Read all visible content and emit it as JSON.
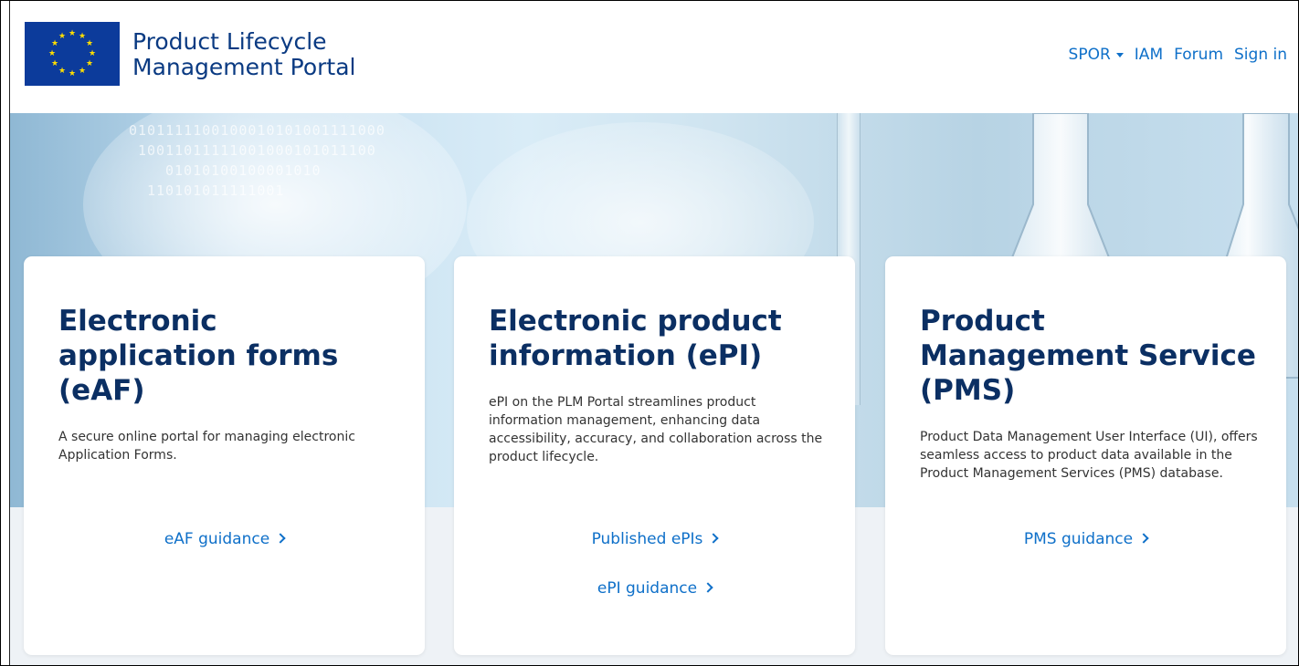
{
  "header": {
    "logo_alt": "EU flag",
    "brand_line1": "Product Lifecycle",
    "brand_line2": "Management Portal",
    "nav": {
      "spor": "SPOR",
      "iam": "IAM",
      "forum": "Forum",
      "sign_in": "Sign in"
    }
  },
  "hero": {
    "digits": [
      "0101111100100010101001111000",
      "10011011111001000101011100",
      "01010100100001010",
      "110101011111001"
    ]
  },
  "cards": [
    {
      "title": "Electronic application forms (eAF)",
      "description": "A secure online portal for managing electronic Application Forms.",
      "links": [
        "eAF guidance"
      ]
    },
    {
      "title": "Electronic product information (ePI)",
      "description": "ePI on the PLM Portal streamlines product information management, enhancing data accessibility, accuracy, and collaboration across the product lifecycle.",
      "links": [
        "Published ePIs",
        "ePI guidance"
      ]
    },
    {
      "title": "Product Management Service (PMS)",
      "description": "Product Data Management User Interface (UI), offers seamless access to product data available in the Product Management Services (PMS) database.",
      "links": [
        "PMS guidance"
      ]
    }
  ],
  "colors": {
    "brand": "#0a3a82",
    "link": "#0f70c9",
    "title": "#0b2f63",
    "flag_blue": "#0c3b9b",
    "flag_star": "#ffde00"
  }
}
